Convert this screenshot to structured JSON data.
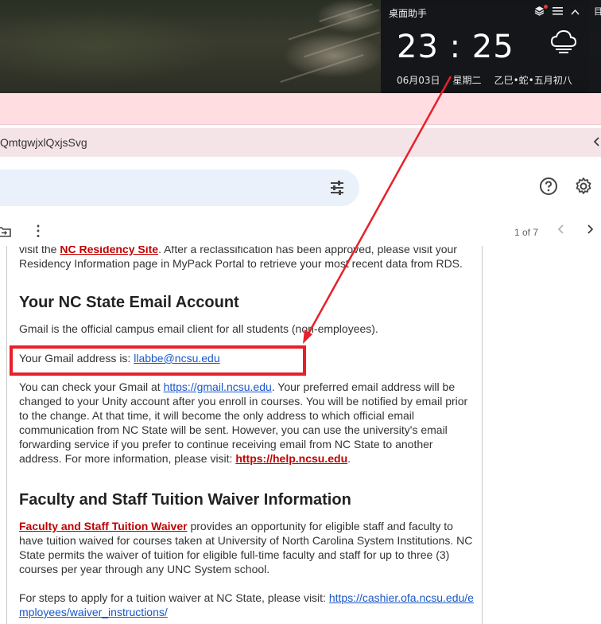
{
  "desktop_widget": {
    "title": "桌面助手",
    "time": "23 : 25",
    "date": "06月03日",
    "weekday": "星期二",
    "lunar": "乙巳•蛇•五月初八",
    "edge_label": "目"
  },
  "browser": {
    "url_fragment": "QmtgwjxlQxjsSvg"
  },
  "toolbar": {
    "pager": "1 of 7"
  },
  "email": {
    "top_para_link": "NC Residency Site",
    "top_para_rest_1": ". After a reclassification has been approved, please visit your ",
    "top_para_line2": "Residency Information page in MyPack Portal to retrieve your most recent data from RDS.",
    "top_para_prefix": "visit the ",
    "heading_email": "Your NC State Email Account",
    "official_text": "Gmail is the official campus email client for all students (non-employees).",
    "address_label": "Your Gmail address is: ",
    "address_value": "llabbe@ncsu.edu",
    "check_prefix": "You can check your Gmail at ",
    "check_link": "https://gmail.ncsu.edu",
    "check_rest": ". Your preferred email address will be changed to your Unity account after you enroll in courses. You will be notified by email prior to the change. At that time, it will become the only address to which official email communication from NC State will be sent. However, you can use the university's email forwarding service if you prefer to continue receiving email from NC State to another address. For more information, please visit: ",
    "help_link": "https://help.ncsu.edu",
    "help_suffix": ".",
    "heading_tuition": "Faculty and Staff Tuition Waiver Information",
    "waiver_link": "Faculty and Staff Tuition Waiver",
    "waiver_rest": " provides an opportunity for eligible staff and faculty to have tuition waived for courses taken at University of North Carolina System Institutions. NC State permits the waiver of tuition for eligible full-time faculty and staff for up to three (3) courses per year through any UNC System school.",
    "steps_prefix": "For steps to apply for a tuition waiver at NC State, please visit: ",
    "steps_link": "https://cashier.ofa.ncsu.edu/employees/waiver_instructions/"
  },
  "colors": {
    "annotation": "#e8202a",
    "link_blue": "#1a57c8",
    "link_red": "#c00000",
    "banner_pink": "#ffdde0",
    "search_bg": "#eaf1fb"
  }
}
